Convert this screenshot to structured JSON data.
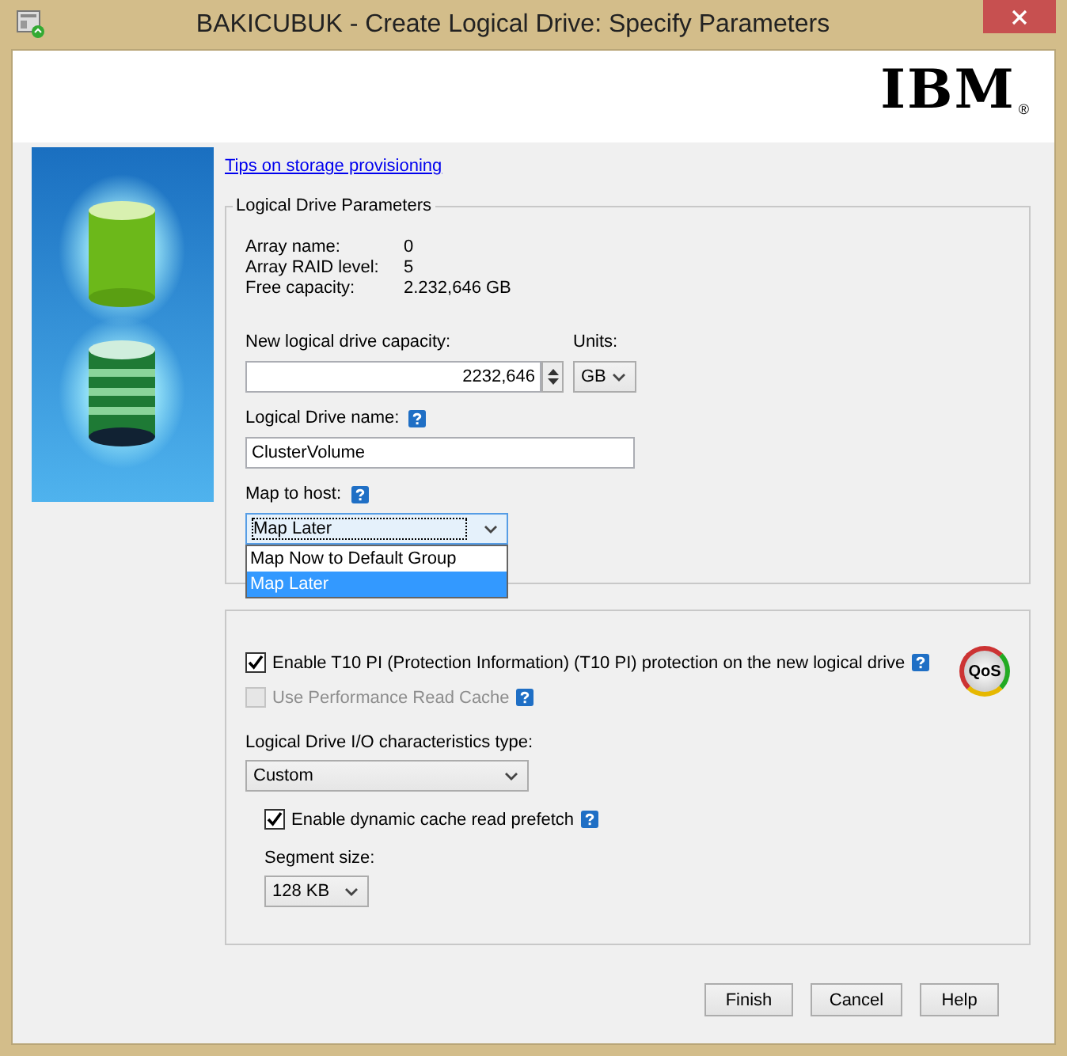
{
  "window": {
    "title": "BAKICUBUK - Create Logical Drive: Specify Parameters"
  },
  "logo": {
    "text": "IBM",
    "mark": "®"
  },
  "tips_link": "Tips on storage provisioning",
  "parameters": {
    "legend": "Logical Drive Parameters",
    "info": [
      {
        "label": "Array name:",
        "value": "0"
      },
      {
        "label": "Array RAID level:",
        "value": "5"
      },
      {
        "label": "Free capacity:",
        "value": "2.232,646 GB"
      }
    ],
    "capacity": {
      "label": "New logical drive capacity:",
      "value": "2232,646"
    },
    "units": {
      "label": "Units:",
      "value": "GB"
    },
    "name": {
      "label": "Logical Drive name:",
      "value": "ClusterVolume"
    },
    "map_to_host": {
      "label": "Map to host:",
      "value": "Map Later",
      "expanded": true,
      "options": [
        {
          "label": "Map Now to Default Group",
          "selected": false
        },
        {
          "label": "Map Later",
          "selected": true
        }
      ]
    }
  },
  "qos": {
    "badge": "QoS",
    "checkboxes": [
      {
        "label": "Enable T10 PI (Protection Information) (T10 PI) protection on the new logical drive",
        "checked": true,
        "disabled": false
      },
      {
        "label": "Use Performance Read Cache",
        "checked": false,
        "disabled": true
      }
    ],
    "io_type": {
      "label": "Logical Drive I/O characteristics type:",
      "value": "Custom"
    },
    "prefetch": {
      "label": "Enable dynamic cache read prefetch",
      "checked": true
    },
    "segment": {
      "label": "Segment size:",
      "value": "128 KB"
    }
  },
  "buttons": [
    "Finish",
    "Cancel",
    "Help"
  ]
}
